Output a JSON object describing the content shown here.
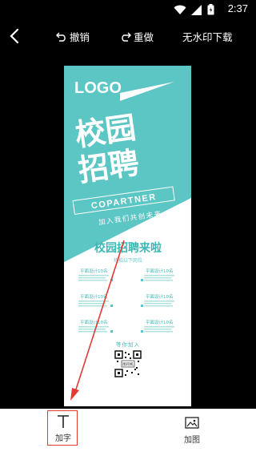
{
  "status_bar": {
    "time": "2:37",
    "icons": [
      "wifi-icon",
      "signal-icon",
      "battery-icon"
    ]
  },
  "toolbar": {
    "undo_label": "撤销",
    "redo_label": "重做",
    "save_label": "无水印下载"
  },
  "poster": {
    "logo": "LOGO",
    "title_line1": "校园",
    "title_line2": "招聘",
    "copartner": "COPARTNER",
    "slogan": "加入我们共创未来",
    "heading": "校园招聘来啦",
    "subheading": "热招以下岗位",
    "jobs": [
      "平面设计10名",
      "平面设计10名",
      "平面设计10名",
      "平面设计10名",
      "平面设计10名",
      "平面设计10名"
    ],
    "join": "等你加入",
    "qr_label": "图司机"
  },
  "bottom_bar": {
    "add_text_label": "加字",
    "add_image_label": "加图"
  },
  "colors": {
    "accent": "#5cc6c4",
    "highlight": "#e53935",
    "background": "#000000"
  }
}
